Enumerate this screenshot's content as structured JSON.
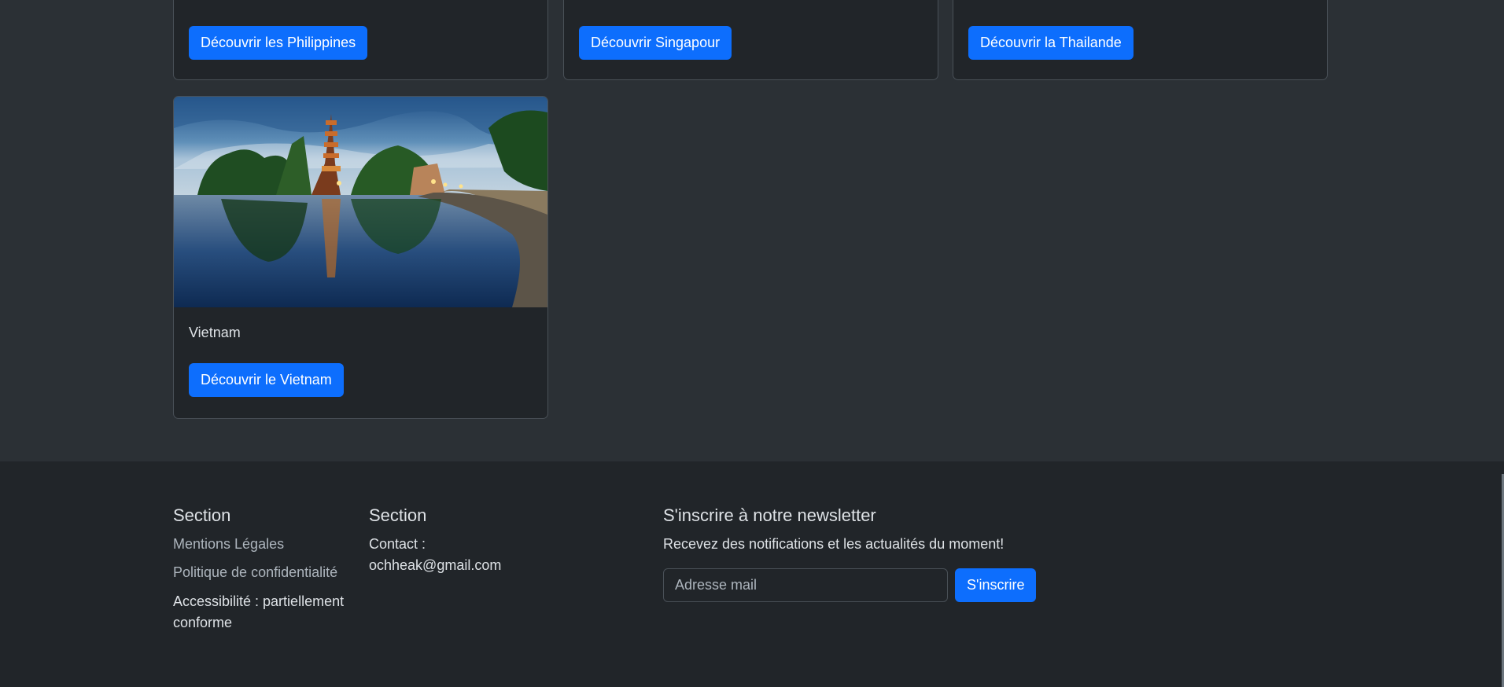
{
  "destinations": {
    "philippines": {
      "button_label": "Découvrir les Philippines"
    },
    "singapore": {
      "button_label": "Découvrir Singapour"
    },
    "thailand": {
      "button_label": "Découvrir la Thailande"
    },
    "vietnam": {
      "title": "Vietnam",
      "button_label": "Découvrir le Vietnam",
      "image": "vietnam-pagoda-lake-photo"
    }
  },
  "footer": {
    "col1": {
      "heading": "Section",
      "links": [
        "Mentions Légales",
        "Politique de confidentialité"
      ],
      "accessibility": "Accessibilité : partiellement conforme"
    },
    "col2": {
      "heading": "Section",
      "contact": "Contact : ochheak@gmail.com"
    },
    "newsletter": {
      "heading": "S'inscrire à notre newsletter",
      "description": "Recevez des notifications et les actualités du moment!",
      "email_placeholder": "Adresse mail",
      "subscribe_label": "S'inscrire"
    }
  },
  "colors": {
    "page_bg": "#2b3035",
    "card_bg": "#212529",
    "footer_bg": "#212529",
    "primary": "#0d6efd",
    "muted_text": "#adb5bd"
  }
}
